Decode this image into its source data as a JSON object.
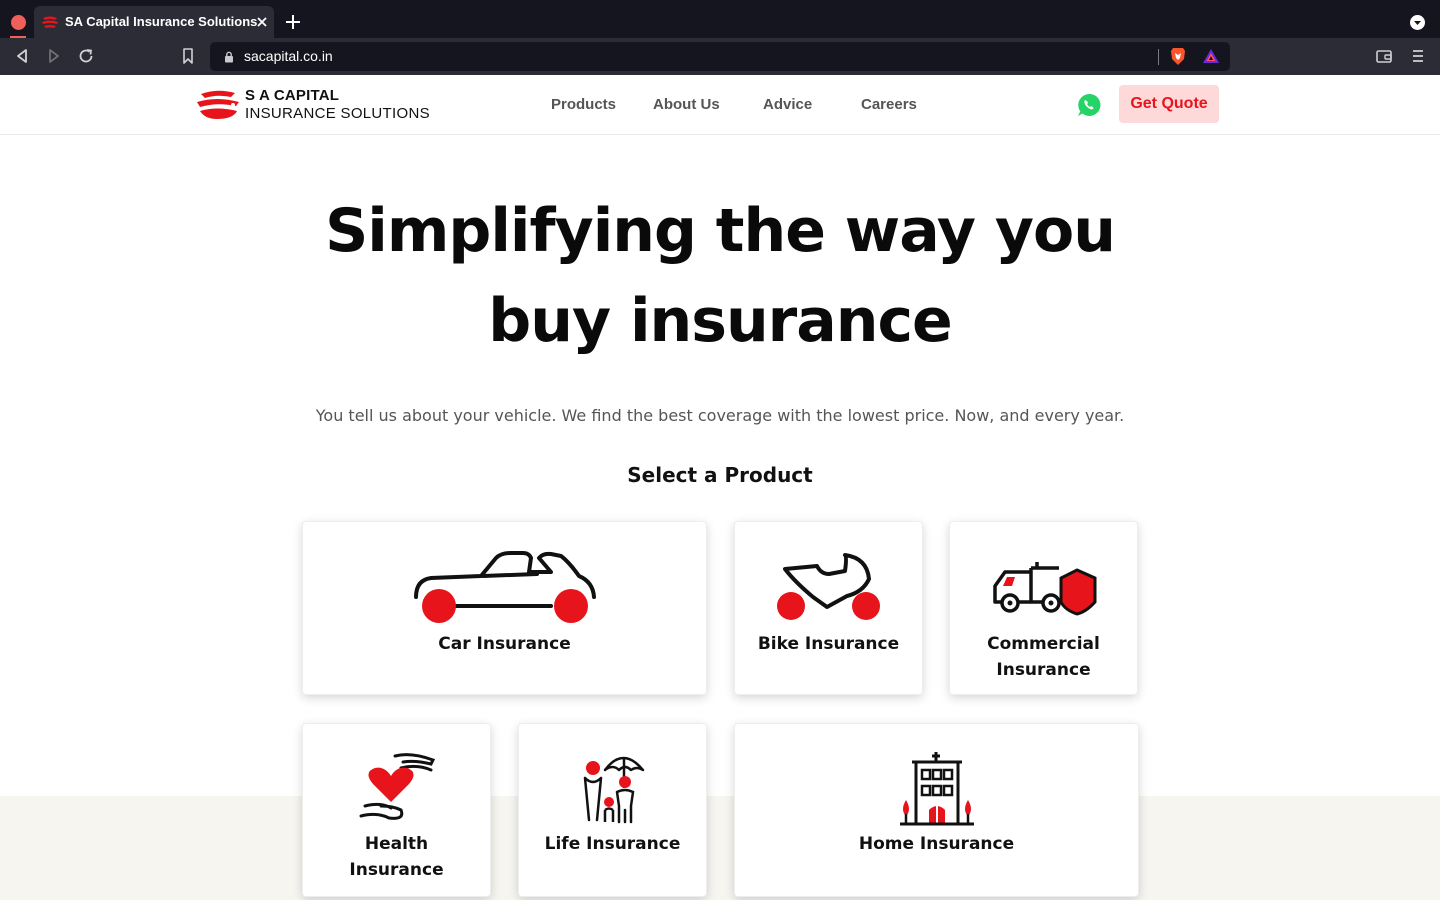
{
  "browser": {
    "tab_title": "SA Capital Insurance Solutions",
    "url": "sacapital.co.in"
  },
  "header": {
    "logo_line1": "S A CAPITAL",
    "logo_line2": "INSURANCE SOLUTIONS",
    "nav": [
      "Products",
      "About Us",
      "Advice",
      "Careers"
    ],
    "quote_button": "Get Quote"
  },
  "hero": {
    "title_line1": "Simplifying the way you",
    "title_line2": "buy insurance",
    "subtitle": "You tell us about your vehicle. We find the best coverage with the lowest price. Now, and every year.",
    "select_title": "Select a Product"
  },
  "products": [
    {
      "label": "Car Insurance",
      "icon": "car-icon"
    },
    {
      "label": "Bike Insurance",
      "icon": "bike-icon"
    },
    {
      "label_line1": "Commercial",
      "label_line2": "Insurance",
      "icon": "truck-icon"
    },
    {
      "label_line1": "Health",
      "label_line2": "Insurance",
      "icon": "heart-hands-icon"
    },
    {
      "label": "Life Insurance",
      "icon": "family-umbrella-icon"
    },
    {
      "label": "Home Insurance",
      "icon": "building-icon"
    }
  ],
  "colors": {
    "brand_red": "#e8141b",
    "quote_bg": "#fdd9da",
    "whatsapp_green": "#25d366"
  }
}
